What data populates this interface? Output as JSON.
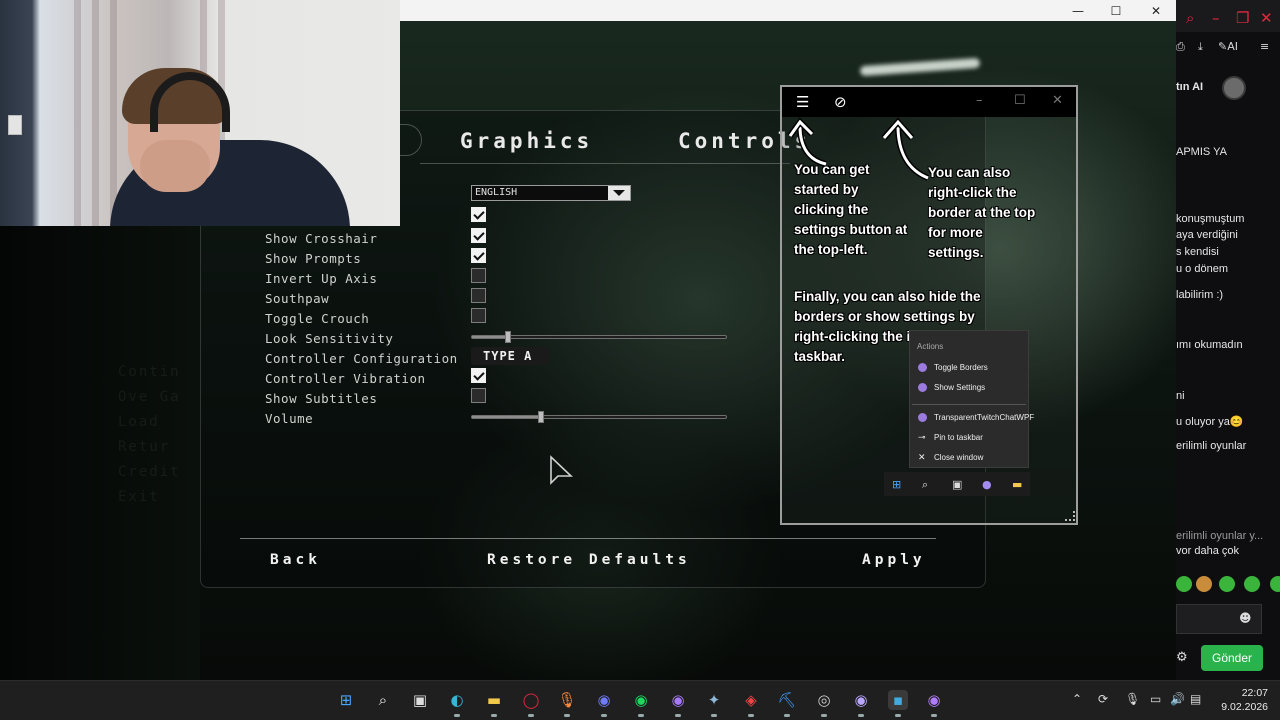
{
  "window": {
    "minimize": "—",
    "maximize": "☐",
    "close": "✕"
  },
  "game": {
    "tabs": [
      {
        "label": "Graphics"
      },
      {
        "label": "Controls"
      }
    ],
    "language": "ENGLISH",
    "options": [
      {
        "label": "Show Crosshair",
        "checked": true
      },
      {
        "label": "Show Prompts",
        "checked": true
      },
      {
        "label": "Invert Up Axis",
        "checked": false
      },
      {
        "label": "Southpaw",
        "checked": false
      },
      {
        "label": "Toggle Crouch",
        "checked": false
      },
      {
        "label": "Look Sensitivity",
        "slider": 0.14
      },
      {
        "label": "Controller Configuration",
        "value": "TYPE A"
      },
      {
        "label": "Controller Vibration",
        "checked": true
      },
      {
        "label": "Show Subtitles",
        "checked": false
      },
      {
        "label": "Volume",
        "slider": 0.27
      }
    ],
    "top_checkbox_checked": true,
    "buttons": {
      "back": "Back",
      "restore": "Restore Defaults",
      "apply": "Apply"
    }
  },
  "overlay": {
    "tip_left": "You can get started by clicking the settings button at the top-left.",
    "tip_right": "You can also right-click the border at the top for more settings.",
    "tip_bottom": "Finally, you can also hide the borders or show settings by right-clicking the icon in your taskbar.",
    "context_menu": {
      "header": "Actions",
      "items": [
        "Toggle Borders",
        "Show Settings"
      ],
      "app_name": "TransparentTwitchChatWPF",
      "pin": "Pin to taskbar",
      "close": "Close window"
    }
  },
  "chat": {
    "header_name": "tın AI",
    "lines": [
      "APMIS YA",
      "konuşmuştum",
      "aya verdiğini",
      "s kendisi",
      "u o dönem",
      "labilirim :)",
      "ımı okumadın",
      "ni",
      "u oluyor ya😊",
      "erilimli oyunlar",
      "erilimli oyunlar y...",
      "vor daha çok"
    ],
    "send": "Gönder"
  },
  "taskbar": {
    "time": "22:07",
    "date": "9.02.2026"
  },
  "colors": {
    "accent_green": "#2ab34a",
    "chat_red": "#e3283e"
  }
}
